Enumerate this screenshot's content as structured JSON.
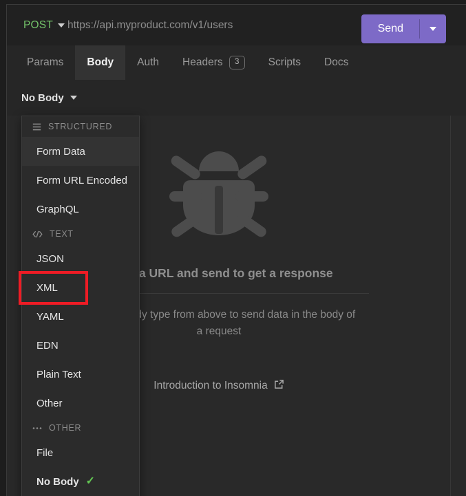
{
  "request_bar": {
    "method": "POST",
    "method_caret_icon": "chevron-down-icon",
    "url": "https://api.myproduct.com/v1/users",
    "send_label": "Send",
    "send_caret_icon": "chevron-down-icon",
    "accent_color": "#7d6ac7",
    "method_color": "#74c46a"
  },
  "tabs": [
    {
      "label": "Params",
      "active": false,
      "badge": null
    },
    {
      "label": "Body",
      "active": true,
      "badge": null
    },
    {
      "label": "Auth",
      "active": false,
      "badge": null
    },
    {
      "label": "Headers",
      "active": false,
      "badge": "3"
    },
    {
      "label": "Scripts",
      "active": false,
      "badge": null
    },
    {
      "label": "Docs",
      "active": false,
      "badge": null
    }
  ],
  "body_type_selector": {
    "label": "No Body",
    "caret_icon": "chevron-down-icon"
  },
  "dropdown": {
    "groups": [
      {
        "header": "STRUCTURED",
        "header_icon": "hamburger-icon",
        "items": [
          {
            "label": "Form Data",
            "state": "hovered"
          },
          {
            "label": "Form URL Encoded",
            "state": "normal"
          },
          {
            "label": "GraphQL",
            "state": "normal"
          }
        ]
      },
      {
        "header": "TEXT",
        "header_icon": "code-icon",
        "items": [
          {
            "label": "JSON",
            "state": "normal"
          },
          {
            "label": "XML",
            "state": "highlighted"
          },
          {
            "label": "YAML",
            "state": "normal"
          },
          {
            "label": "EDN",
            "state": "normal"
          },
          {
            "label": "Plain Text",
            "state": "normal"
          },
          {
            "label": "Other",
            "state": "normal"
          }
        ]
      },
      {
        "header": "OTHER",
        "header_icon": "ellipsis-icon",
        "items": [
          {
            "label": "File",
            "state": "normal"
          },
          {
            "label": "No Body",
            "state": "selected",
            "check": "✓"
          }
        ]
      }
    ],
    "check_color": "#63c653"
  },
  "empty_state": {
    "illustration_icon": "bug-icon",
    "title": "Enter a URL and send to get a response",
    "subtitle": "Select a body type from above to send data in the body of a request",
    "link_label": "Introduction to Insomnia",
    "link_icon": "external-link-icon"
  },
  "annotation": {
    "target": "XML",
    "color": "#ee1c25"
  }
}
